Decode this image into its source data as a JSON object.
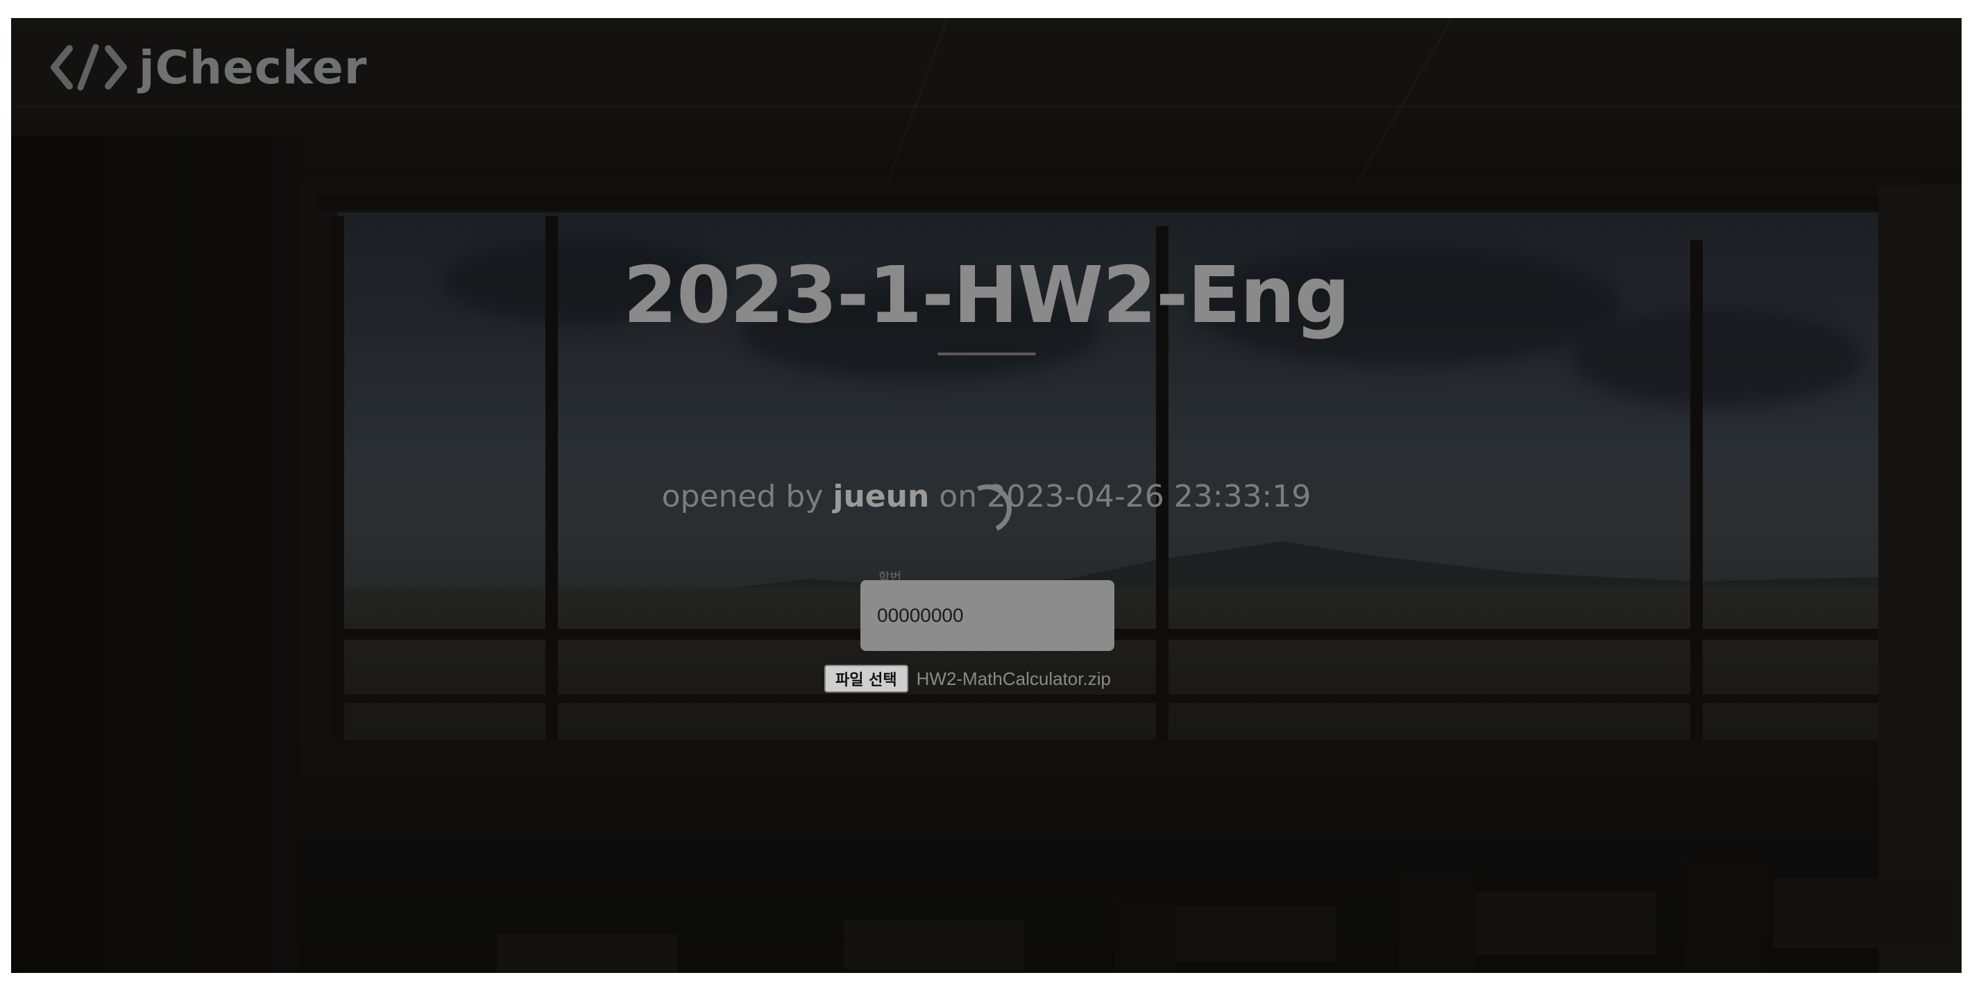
{
  "app": {
    "brand_name": "jChecker",
    "brand_icon": "code-brackets-icon"
  },
  "assignment": {
    "title": "2023-1-HW2-Eng",
    "opened_prefix": "opened by ",
    "author": "jueun",
    "opened_mid": " on ",
    "opened_timestamp": "2023-04-26 23:33:19"
  },
  "form": {
    "student_id_label": "학번",
    "student_id_value": "00000000",
    "file_button_label": "파일 선택",
    "file_name": "HW2-MathCalculator.zip"
  },
  "status": {
    "loading_icon": "spinner-icon"
  },
  "colors": {
    "overlay": "#000000",
    "input_bg": "#8c8c8c",
    "title_text": "#8a8a8a"
  }
}
